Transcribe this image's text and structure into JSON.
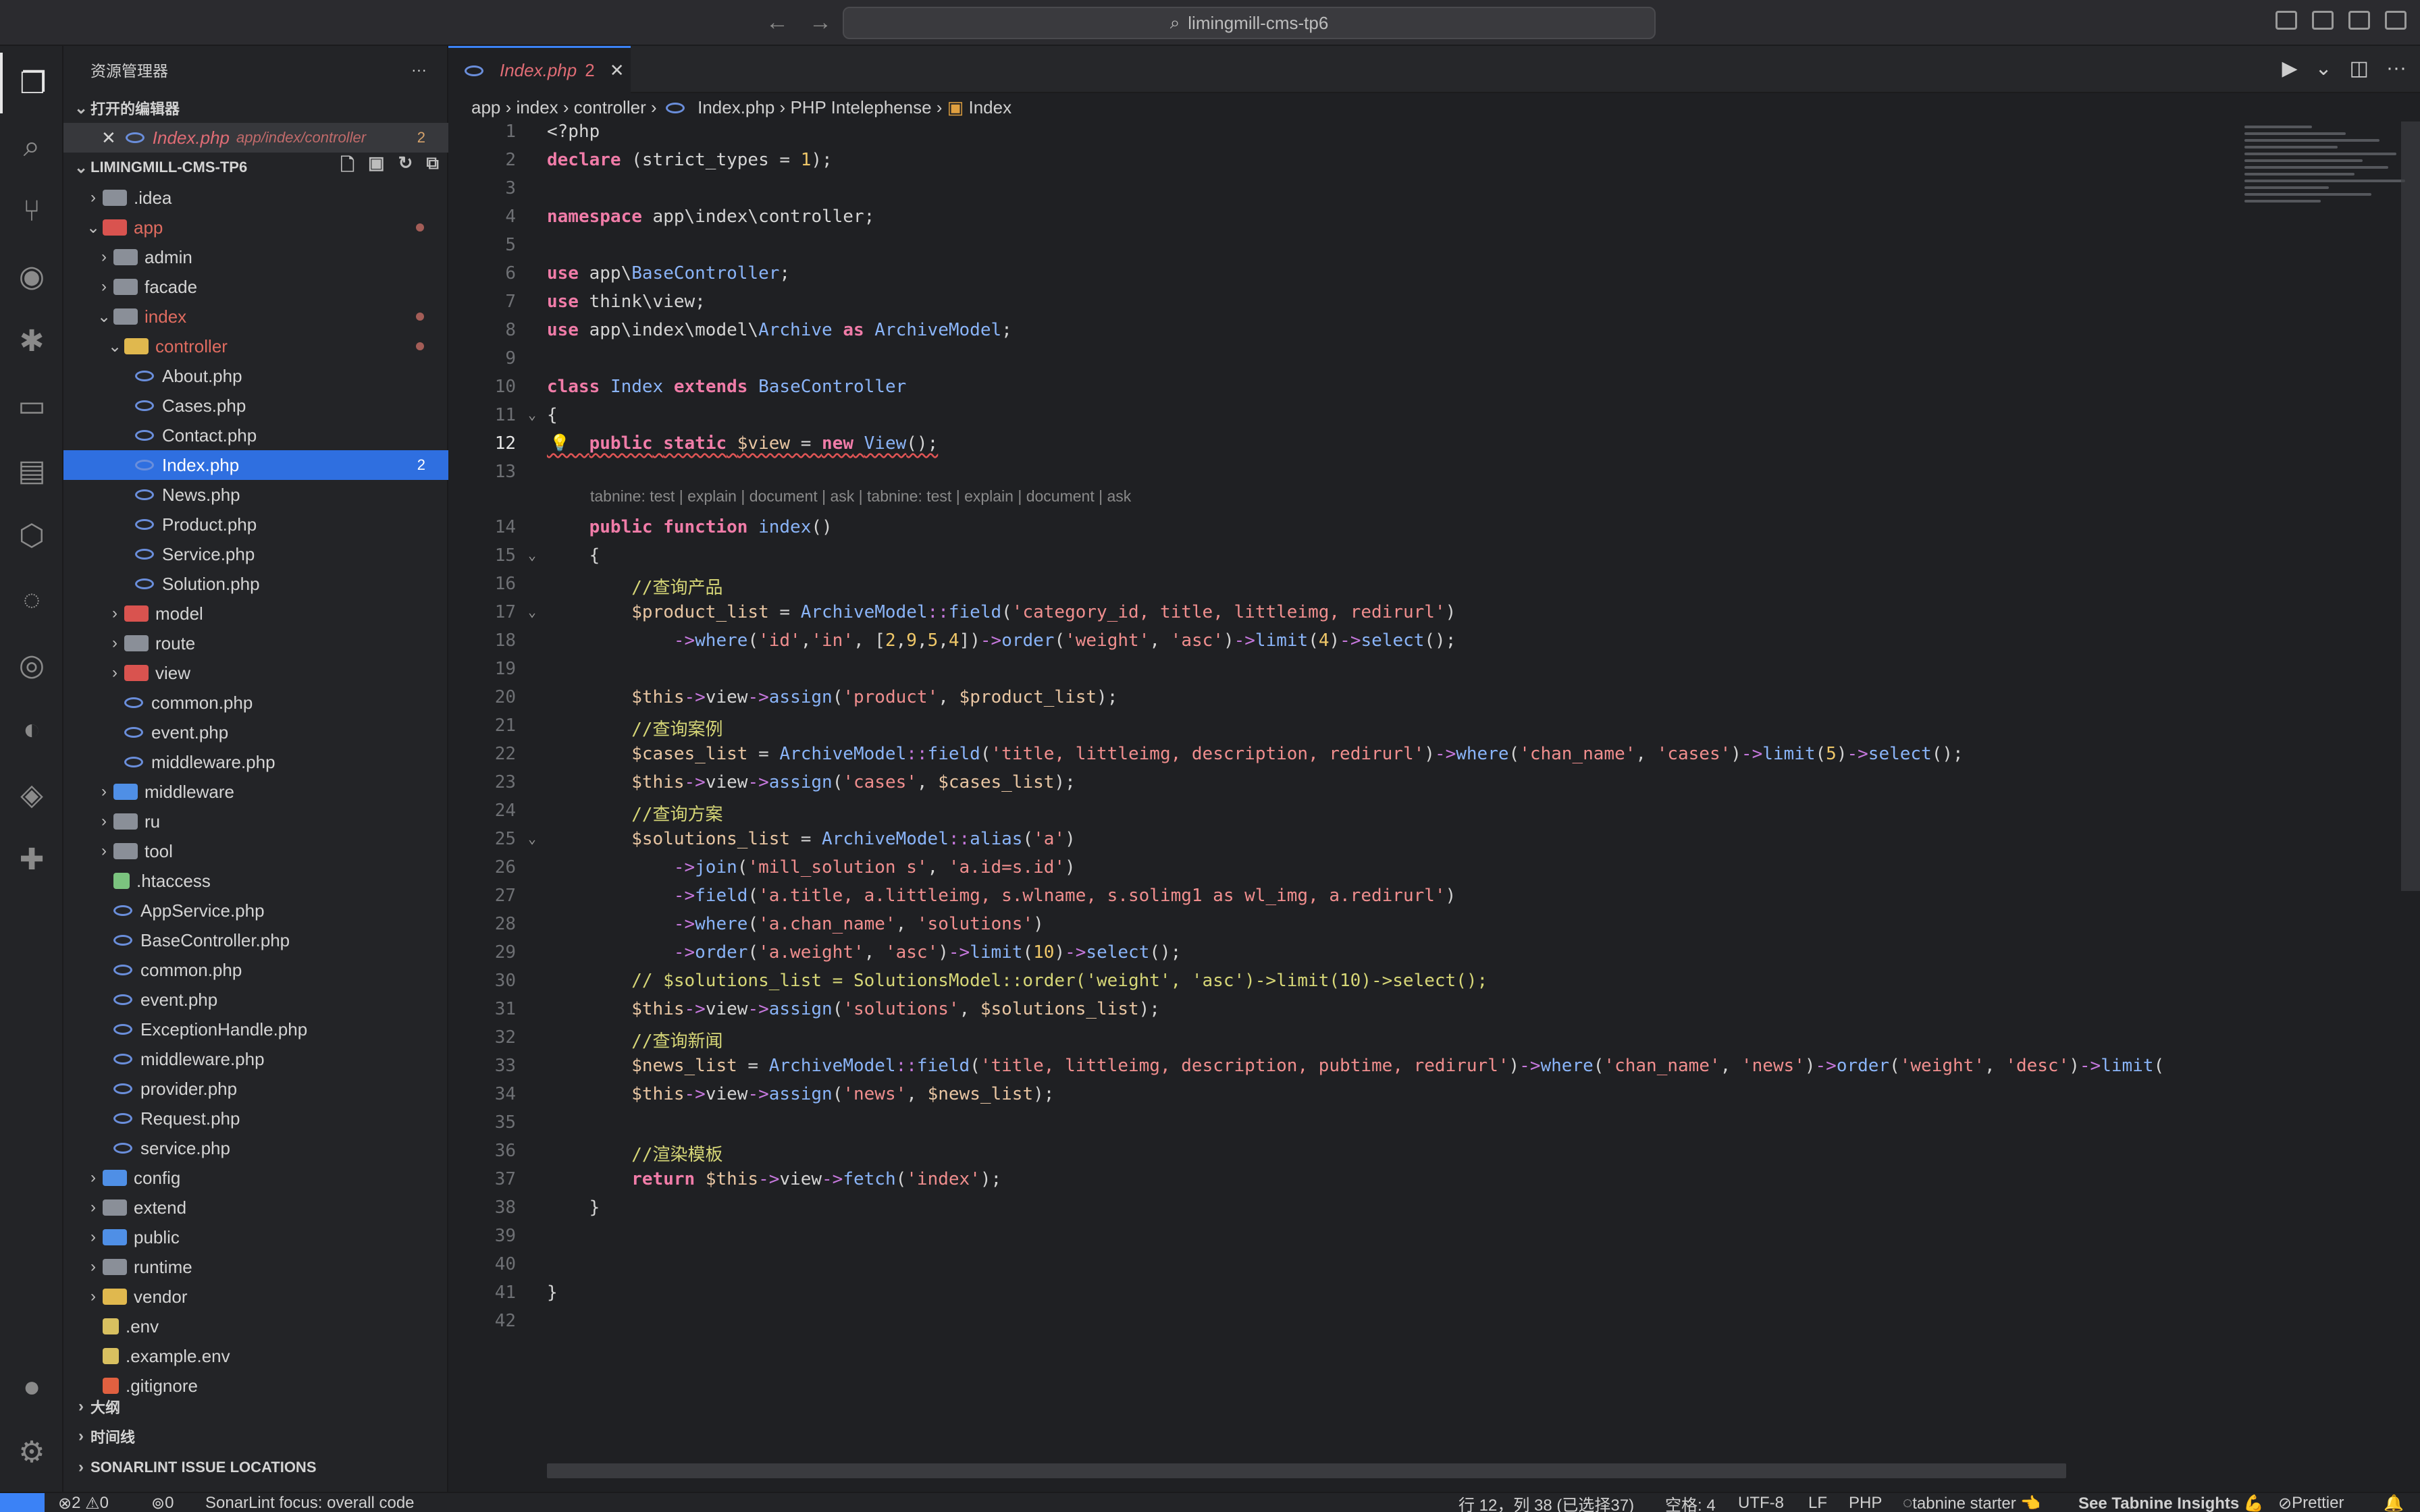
{
  "titlebar": {
    "search_text": "limingmill-cms-tp6",
    "back_icon": "←",
    "forward_icon": "→"
  },
  "activity_bar": {
    "items": [
      "explorer-icon",
      "search-icon",
      "source-control-icon",
      "github-icon",
      "debug-icon",
      "remote-explorer-icon",
      "docker-icon",
      "testing-icon",
      "timeline-icon",
      "sonarlint-icon",
      "edge-icon",
      "gitlens-icon",
      "extensions-icon",
      "account-icon",
      "settings-icon"
    ]
  },
  "sidebar": {
    "title": "资源管理器",
    "more_label": "···",
    "open_editors": {
      "label": "打开的编辑器",
      "items": [
        {
          "name": "Index.php",
          "path": "app/index/controller",
          "badge": "2"
        }
      ]
    },
    "project": {
      "label": "LIMINGMILL-CMS-TP6"
    },
    "tree": [
      {
        "name": ".idea"
      },
      {
        "name": "app"
      },
      {
        "name": "admin"
      },
      {
        "name": "facade"
      },
      {
        "name": "index"
      },
      {
        "name": "controller"
      },
      {
        "name": "About.php"
      },
      {
        "name": "Cases.php"
      },
      {
        "name": "Contact.php"
      },
      {
        "name": "Index.php",
        "badge": "2"
      },
      {
        "name": "News.php"
      },
      {
        "name": "Product.php"
      },
      {
        "name": "Service.php"
      },
      {
        "name": "Solution.php"
      },
      {
        "name": "model"
      },
      {
        "name": "route"
      },
      {
        "name": "view"
      },
      {
        "name": "common.php"
      },
      {
        "name": "event.php"
      },
      {
        "name": "middleware.php"
      },
      {
        "name": "middleware"
      },
      {
        "name": "ru"
      },
      {
        "name": "tool"
      },
      {
        "name": ".htaccess"
      },
      {
        "name": "AppService.php"
      },
      {
        "name": "BaseController.php"
      },
      {
        "name": "common.php"
      },
      {
        "name": "event.php"
      },
      {
        "name": "ExceptionHandle.php"
      },
      {
        "name": "middleware.php"
      },
      {
        "name": "provider.php"
      },
      {
        "name": "Request.php"
      },
      {
        "name": "service.php"
      },
      {
        "name": "config"
      },
      {
        "name": "extend"
      },
      {
        "name": "public"
      },
      {
        "name": "runtime"
      },
      {
        "name": "vendor"
      },
      {
        "name": ".env"
      },
      {
        "name": ".example.env"
      },
      {
        "name": ".gitignore"
      }
    ],
    "outline_label": "大纲",
    "timeline_label": "时间线",
    "sonarlint_label": "SONARLINT ISSUE LOCATIONS"
  },
  "editor": {
    "tab": {
      "name": "Index.php",
      "badge": "2"
    },
    "breadcrumb": [
      "app",
      "index",
      "controller",
      "Index.php",
      "PHP Intelephense",
      "Index"
    ],
    "codelens": "tabnine: test | explain | document | ask | tabnine: test | explain | document | ask",
    "lines": [
      {
        "n": "1",
        "t": "<?php"
      },
      {
        "n": "2",
        "t": "declare (strict_types = 1);"
      },
      {
        "n": "3",
        "t": ""
      },
      {
        "n": "4",
        "t": "namespace app\\index\\controller;"
      },
      {
        "n": "5",
        "t": ""
      },
      {
        "n": "6",
        "t": "use app\\BaseController;"
      },
      {
        "n": "7",
        "t": "use think\\view;"
      },
      {
        "n": "8",
        "t": "use app\\index\\model\\Archive as ArchiveModel;"
      },
      {
        "n": "9",
        "t": ""
      },
      {
        "n": "10",
        "t": "class Index extends BaseController"
      },
      {
        "n": "11",
        "t": "{"
      },
      {
        "n": "12",
        "t": "    public static $view = new View();"
      },
      {
        "n": "13",
        "t": ""
      },
      {
        "n": "14",
        "t": "    public function index()"
      },
      {
        "n": "15",
        "t": "    {"
      },
      {
        "n": "16",
        "t": "        //查询产品"
      },
      {
        "n": "17",
        "t": "        $product_list = ArchiveModel::field('category_id, title, littleimg, redirurl')"
      },
      {
        "n": "18",
        "t": "            ->where('id','in', [2,9,5,4])->order('weight', 'asc')->limit(4)->select();"
      },
      {
        "n": "19",
        "t": ""
      },
      {
        "n": "20",
        "t": "        $this->view->assign('product', $product_list);"
      },
      {
        "n": "21",
        "t": "        //查询案例"
      },
      {
        "n": "22",
        "t": "        $cases_list = ArchiveModel::field('title, littleimg, description, redirurl')->where('chan_name', 'cases')->limit(5)->select();"
      },
      {
        "n": "23",
        "t": "        $this->view->assign('cases', $cases_list);"
      },
      {
        "n": "24",
        "t": "        //查询方案"
      },
      {
        "n": "25",
        "t": "        $solutions_list = ArchiveModel::alias('a')"
      },
      {
        "n": "26",
        "t": "            ->join('mill_solution s', 'a.id=s.id')"
      },
      {
        "n": "27",
        "t": "            ->field('a.title, a.littleimg, s.wlname, s.solimg1 as wl_img, a.redirurl')"
      },
      {
        "n": "28",
        "t": "            ->where('a.chan_name', 'solutions')"
      },
      {
        "n": "29",
        "t": "            ->order('a.weight', 'asc')->limit(10)->select();"
      },
      {
        "n": "30",
        "t": "        // $solutions_list = SolutionsModel::order('weight', 'asc')->limit(10)->select();"
      },
      {
        "n": "31",
        "t": "        $this->view->assign('solutions', $solutions_list);"
      },
      {
        "n": "32",
        "t": "        //查询新闻"
      },
      {
        "n": "33",
        "t": "        $news_list = ArchiveModel::field('title, littleimg, description, pubtime, redirurl')->where('chan_name', 'news')->order('weight', 'desc')->limit("
      },
      {
        "n": "34",
        "t": "        $this->view->assign('news', $news_list);"
      },
      {
        "n": "35",
        "t": ""
      },
      {
        "n": "36",
        "t": "        //渲染模板"
      },
      {
        "n": "37",
        "t": "        return $this->view->fetch('index');"
      },
      {
        "n": "38",
        "t": "    }"
      },
      {
        "n": "39",
        "t": ""
      },
      {
        "n": "40",
        "t": ""
      },
      {
        "n": "41",
        "t": "}"
      },
      {
        "n": "42",
        "t": ""
      }
    ]
  },
  "statusbar": {
    "errors": "2",
    "warnings": "0",
    "ports": "0",
    "sonarlint": "SonarLint focus: overall code",
    "position": "行 12，列 38 (已选择37)",
    "spaces": "空格: 4",
    "encoding": "UTF-8",
    "eol": "LF",
    "language": "PHP",
    "tabnine": "tabnine starter 👈",
    "insights": "See Tabnine Insights 💪",
    "prettier": "Prettier"
  }
}
